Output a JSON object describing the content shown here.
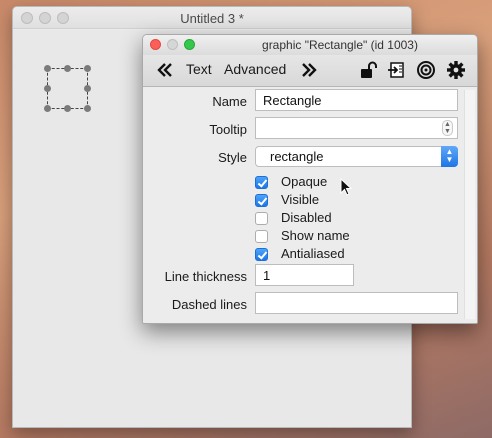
{
  "back_window": {
    "title": "Untitled 3 *"
  },
  "inspector": {
    "title": "graphic \"Rectangle\" (id 1003)",
    "toolbar": {
      "prev_icon": "double-chevron-left-icon",
      "tab_text": "Text",
      "tab_advanced": "Advanced",
      "next_icon": "double-chevron-right-icon",
      "lock_icon": "unlock-icon",
      "script_icon": "script-icon",
      "target_icon": "target-icon",
      "gear_icon": "gear-icon"
    },
    "fields": {
      "name_label": "Name",
      "name_value": "Rectangle",
      "tooltip_label": "Tooltip",
      "tooltip_value": "",
      "style_label": "Style",
      "style_value": "rectangle",
      "line_thickness_label": "Line thickness",
      "line_thickness_value": "1",
      "dashed_lines_label": "Dashed lines",
      "dashed_lines_value": ""
    },
    "checkboxes": [
      {
        "label": "Opaque",
        "checked": true
      },
      {
        "label": "Visible",
        "checked": true
      },
      {
        "label": "Disabled",
        "checked": false
      },
      {
        "label": "Show name",
        "checked": false
      },
      {
        "label": "Antialiased",
        "checked": true
      }
    ]
  },
  "colors": {
    "accent": "#1d76e8",
    "close": "#fc5f57",
    "maximize": "#34c84a"
  }
}
